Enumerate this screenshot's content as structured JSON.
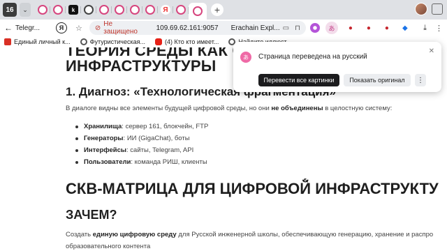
{
  "browser": {
    "tab_count": "16",
    "chevron": "⌄",
    "new_tab": "+",
    "active_tab_title": "Telegr...",
    "address": {
      "insecure_label": "Не защищено",
      "url": "109.69.62.161:9057",
      "site_title": "Erachain Expl..."
    }
  },
  "bookmarks": [
    {
      "label": "Единый личный к...",
      "icon": "red"
    },
    {
      "label": "Футуристическая...",
      "icon": "ring"
    },
    {
      "label": "(4) Кто кто имеет...",
      "icon": "yt"
    },
    {
      "label": "Найдите иллюст...",
      "icon": "ring"
    }
  ],
  "page": {
    "h1_line1": "ТЕОРИЯ СРЕДЫ КАК С",
    "h1_line2": "ИНФРАСТРУКТУРЫ",
    "h2": "1. Диагноз: «Технологическая фрагментация»",
    "intro_before": "В диалоге видны все элементы будущей цифровой среды, но они ",
    "intro_bold": "не объединены",
    "intro_after": " в целостную систему:",
    "items": [
      {
        "term": "Хранилища",
        "desc": ": сервер 161, блокчейн, FTP"
      },
      {
        "term": "Генераторы",
        "desc": ": ИИ (GigaChat), боты"
      },
      {
        "term": "Интерфейсы",
        "desc": ": сайты, Telegram, API"
      },
      {
        "term": "Пользователи",
        "desc": ": команда РИШ, клиенты"
      }
    ],
    "section_title": "СКВ-МАТРИЦА ДЛЯ ЦИФРОВОЙ ИНФРАСТРУКТУ",
    "why_title": "ЗАЧЕМ?",
    "why_before": "Создать ",
    "why_bold": "единую цифровую среду",
    "why_after": " для Русской инженерной школы, обеспечивающую генерацию, хранение и распро",
    "why_line2": "образовательного контента"
  },
  "translate_popup": {
    "title": "Страница переведена на русский",
    "icon_glyph": "あ",
    "primary_button": "Перевести все картинки",
    "secondary_button": "Показать оригинал",
    "more": "⋮",
    "close": "✕"
  }
}
